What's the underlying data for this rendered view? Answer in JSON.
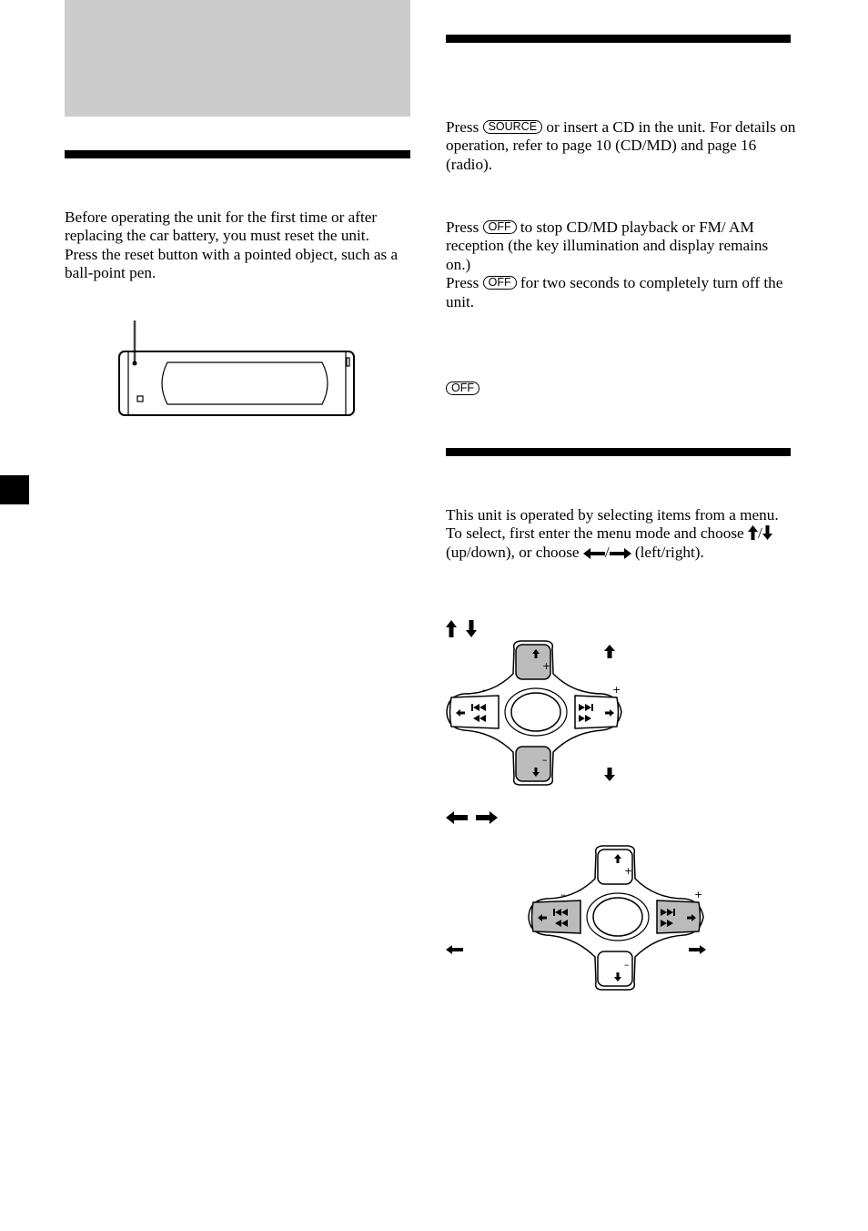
{
  "page": {
    "left_column": {
      "reset_section": {
        "paragraphs": [
          "Before operating the unit for the first time or after replacing the car battery, you must reset the unit.",
          "Press the reset button with a pointed object, such as a ball-point pen."
        ],
        "illustration": "front-panel-with-reset-button"
      }
    },
    "right_column": {
      "turn_on_section": {
        "press": "Press",
        "key_source": "SOURCE",
        "text": "or insert a CD in the unit. For details on operation, refer to page 10 (CD/MD) and page 16 (radio)."
      },
      "turn_off_section": {
        "press1": "Press",
        "key_off": "OFF",
        "text1": "to stop CD/MD playback or FM/ AM reception (the key illumination and display remains on.)",
        "press2": "Press",
        "text2": "for two seconds to completely turn off the unit.",
        "standalone_key": "OFF"
      },
      "menu_section": {
        "line1": "This unit is operated by selecting items from a menu.",
        "line2a": "To select, first enter the menu mode and choose",
        "slash": "/",
        "line2b": "(up/down), or choose",
        "line2c": "(left/right).",
        "diagram_updown": {
          "plus_label": "+",
          "minus_label": "–"
        },
        "diagram_leftright": {
          "plus_label": "+",
          "minus_label": "–"
        }
      }
    },
    "colors": {
      "gray_box": "#cccccc",
      "highlight_button": "#bbbbbb",
      "rule": "#000000"
    }
  }
}
